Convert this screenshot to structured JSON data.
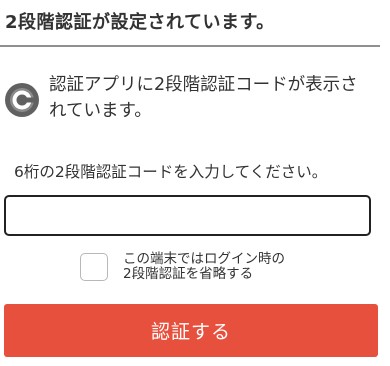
{
  "header": {
    "title": "2段階認証が設定されています。"
  },
  "app_notice": {
    "icon": "authenticator-app-icon",
    "text": "認証アプリに2段階認証コードが表示されています。"
  },
  "form": {
    "instruction": "6桁の2段階認証コードを入力してください。",
    "code_value": "",
    "code_placeholder": ""
  },
  "skip_option": {
    "checked": false,
    "label_line1": "この端末ではログイン時の",
    "label_line2": "2段階認証を省略する"
  },
  "submit": {
    "label": "認証する"
  },
  "colors": {
    "accent": "#e8503e",
    "text": "#333333",
    "divider": "#909090"
  }
}
